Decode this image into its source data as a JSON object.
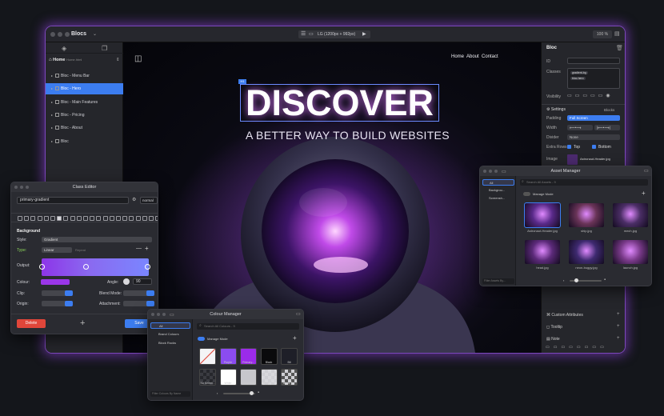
{
  "window": {
    "app_title": "Blocs",
    "device_label": "LG (1200px + 992px)",
    "zoom": "100 %"
  },
  "sidebar": {
    "page_label": "Home",
    "page_sub": "Home.html",
    "items": [
      {
        "label": "Bloc - Menu Bar"
      },
      {
        "label": "Bloc - Hero"
      },
      {
        "label": "Bloc - Main Features"
      },
      {
        "label": "Bloc - Pricing"
      },
      {
        "label": "Bloc - About"
      },
      {
        "label": "Bloc"
      }
    ]
  },
  "canvas": {
    "nav": [
      "Home",
      "About",
      "Contact"
    ],
    "badge": "H1",
    "headline": "DISCOVER",
    "subheadline": "A BETTER WAY TO BUILD WEBSITES"
  },
  "inspector": {
    "title": "Bloc",
    "id_label": "ID",
    "classes_label": "Classes",
    "class_tags": [
      "gradient-bg",
      "bloc-hero"
    ],
    "visibility_label": "Visibility",
    "settings_label": "Settings",
    "blocks_label": "Blocks",
    "padding_label": "Padding",
    "padding_value": "Full Screen",
    "width_label": "Width",
    "divider_label": "Divider",
    "divider_value": "None",
    "extra_rows_label": "Extra Rows",
    "extra_rows_top": "Top",
    "extra_rows_bottom": "Bottom",
    "image_label": "Image",
    "image_value": "Astronaut-Header.jpg",
    "custom_attributes": "Custom Attributes",
    "tooltip": "Tooltip",
    "note": "Note"
  },
  "class_editor": {
    "title": "Class Editor",
    "class_name": "primary-gradient",
    "state": "normal",
    "section": "Background",
    "style_label": "Style:",
    "style_value": "Gradient",
    "type_label": "Type:",
    "type_value": "Linear",
    "repeat_label": "Repeat",
    "output_label": "Output:",
    "colour_label": "Colour:",
    "angle_label": "Angle:",
    "angle_value": "90",
    "clip_label": "Clip:",
    "blend_label": "Blend Mode:",
    "origin_label": "Origin:",
    "attachment_label": "Attachment:",
    "delete_label": "Delete",
    "save_label": "Save",
    "accent": "#3c7df0",
    "gradient_color": "#9a36e8"
  },
  "asset_manager": {
    "title": "Asset Manager",
    "folders": [
      "All",
      "Backgrou...",
      "Screensh..."
    ],
    "search_placeholder": "Search All Assets - 9",
    "manage_mode": "Manage Mode",
    "footer_placeholder": "Filter Assets By...",
    "assets": [
      {
        "name": "Astronaut-Header.jpg",
        "color": "#5a2a8a",
        "selected": true
      },
      {
        "name": "ship.jpg",
        "color": "#6a3458",
        "selected": false
      },
      {
        "name": "mech.jpg",
        "color": "#4b2e66",
        "selected": false
      },
      {
        "name": "head.jpg",
        "color": "#5c2a7a",
        "selected": false
      },
      {
        "name": "neon-buggy.jpg",
        "color": "#3e2a70",
        "selected": false
      },
      {
        "name": "launch.jpg",
        "color": "#7a3a8a",
        "selected": false
      }
    ]
  },
  "colour_manager": {
    "title": "Colour Manager",
    "folders": [
      "All",
      "Brand Colours",
      "Block Rocks"
    ],
    "search_placeholder": "Search All Colours - 9",
    "manage_mode": "Manage Mode",
    "footer_placeholder": "Filter Colours By Name",
    "swatches": [
      {
        "name": "",
        "color": "#f4f4f6",
        "none": true
      },
      {
        "name": "Purple",
        "color": "#8b4cf0"
      },
      {
        "name": "Primary...",
        "color": "#9b2bea"
      },
      {
        "name": "Black",
        "color": "#0a0a0c"
      },
      {
        "name": "Bit",
        "color": "#1e1f28"
      },
      {
        "name": "No Select...",
        "color": "#26272c"
      },
      {
        "name": "White",
        "color": "#ffffff"
      },
      {
        "name": "Gray Text",
        "color": "#c7c7cc"
      },
      {
        "name": "White Tr...",
        "color": "#d8d8dc"
      },
      {
        "name": "Black Tr...",
        "color": "#555"
      }
    ]
  }
}
